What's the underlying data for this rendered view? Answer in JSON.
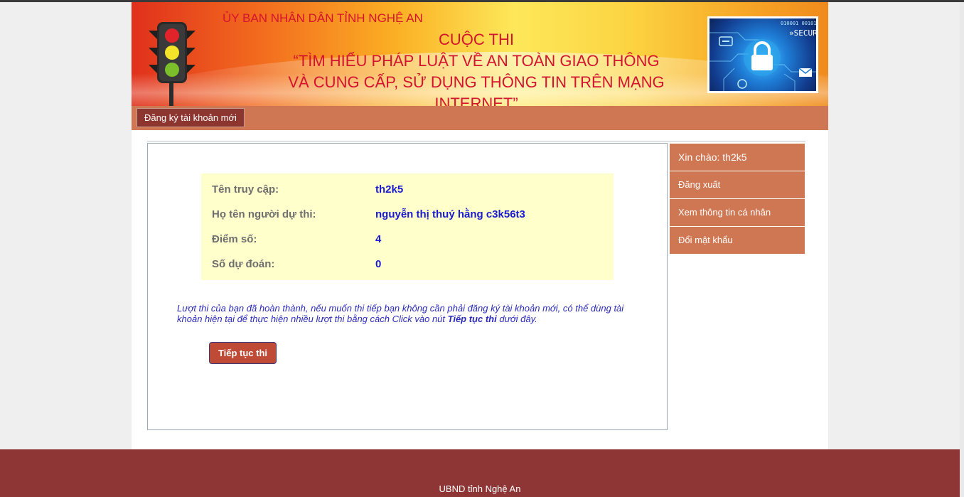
{
  "banner": {
    "gov_name": "ỦY BAN NHÂN DÂN TỈNH NGHỆ AN",
    "title_line1": "CUỘC THI",
    "title_line2": "“TÌM HIỂU PHÁP LUẬT VỀ AN TOÀN GIAO THÔNG",
    "title_line3": "VÀ CUNG CẤP, SỬ DỤNG THÔNG TIN TRÊN MẠNG INTERNET”",
    "security_image_text": "»SECUR",
    "security_image_binary": "010001 00101"
  },
  "nav": {
    "register_label": "Đăng ký tài khoản mới"
  },
  "info": {
    "rows": [
      {
        "label": "Tên truy cập:",
        "value": "th2k5"
      },
      {
        "label": "Họ tên người dự thi:",
        "value": "nguyễn thị thuý hằng c3k56t3"
      },
      {
        "label": "Điểm số:",
        "value": "4"
      },
      {
        "label": "Số dự đoán:",
        "value": "0"
      }
    ]
  },
  "notice": {
    "text_before": "Lượt thi của bạn đã hoàn thành, nếu muốn thi tiếp bạn không cần phải đăng ký tài khoản mới, có thể dùng tài khoản hiện tại để thực hiện nhiều lượt thi bằng cách Click vào nút ",
    "text_bold": "Tiếp tục thi",
    "text_after": " dưới đây."
  },
  "continue_label": "Tiếp tục thi",
  "sidebar": {
    "items": [
      {
        "label": "Xin chào: th2k5"
      },
      {
        "label": "Đăng xuất"
      },
      {
        "label": "Xem thông tin cá nhân"
      },
      {
        "label": "Đổi mật khẩu"
      }
    ]
  },
  "footer": {
    "text": "UBND tỉnh Nghệ An"
  },
  "colors": {
    "accent": "#cf7752",
    "footer": "#8e3635",
    "button": "#bf4a35",
    "info_bg": "#ffffcc",
    "title_red": "#d4132e"
  },
  "icons": [
    "traffic-light-icon",
    "padlock-icon",
    "envelope-icon"
  ]
}
